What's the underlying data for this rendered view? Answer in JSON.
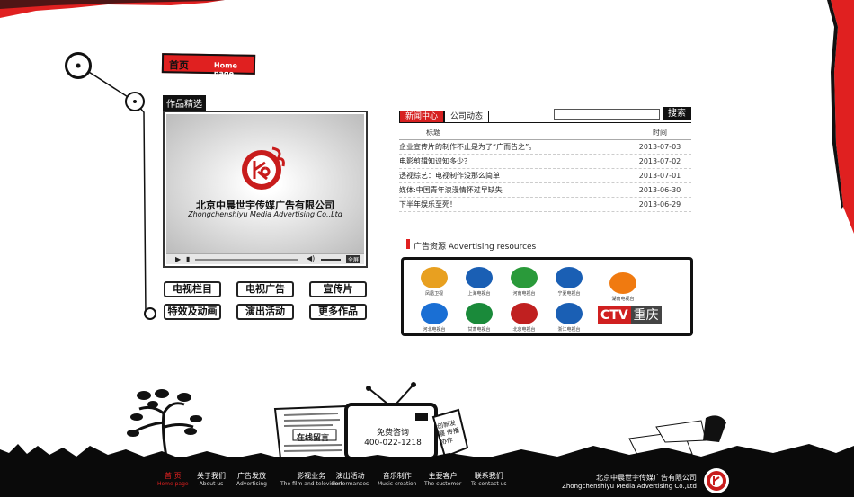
{
  "header": {
    "home_tab_zh": "首页",
    "home_tab_en": "Home page"
  },
  "works": {
    "section_label": "作品精选",
    "video_company_zh": "北京中晨世宇传媒广告有限公司",
    "video_company_en": "Zhongchenshiyu Media Advertising Co.,Ltd",
    "fullscreen_label": "全屏",
    "buttons": [
      "电视栏目",
      "电视广告",
      "宣传片",
      "特效及动画",
      "演出活动",
      "更多作品"
    ]
  },
  "news": {
    "tabs": [
      "新闻中心",
      "公司动态"
    ],
    "search_placeholder": "",
    "search_button": "搜索",
    "col_title": "标题",
    "col_date": "时间",
    "rows": [
      {
        "title": "企业宣传片的制作不止是为了“广而告之”。",
        "date": "2013-07-03"
      },
      {
        "title": "电影剪辑知识知多少？",
        "date": "2013-07-02"
      },
      {
        "title": "透视综艺：电视制作没那么简单",
        "date": "2013-07-01"
      },
      {
        "title": "媒体:中国青年浪漫情怀过早缺失",
        "date": "2013-06-30"
      },
      {
        "title": "下半年娱乐至死！",
        "date": "2013-06-29"
      }
    ]
  },
  "ads": {
    "title": "广告资源 Advertising resources",
    "logos": [
      {
        "name": "凤凰卫视",
        "color": "#e8a020"
      },
      {
        "name": "上海电视台",
        "color": "#1a5fb4"
      },
      {
        "name": "河南电视台",
        "color": "#2a9a3a"
      },
      {
        "name": "宁夏电视台",
        "color": "#1a5fb4"
      },
      {
        "name": "湖南电视台",
        "color": "#f07a10"
      },
      {
        "name": "河北电视台",
        "color": "#1a6fd4"
      },
      {
        "name": "甘肃电视台",
        "color": "#1a8a3a"
      },
      {
        "name": "北京电视台",
        "color": "#c02020"
      },
      {
        "name": "浙江电视台",
        "color": "#1a5fb4"
      },
      {
        "name": "",
        "color": "#d02020"
      }
    ],
    "cctv_text": "CTV",
    "chongqing_text": "重庆"
  },
  "promo": {
    "consult_label": "免费咨询",
    "phone": "400-022-1218",
    "online_msg": "在线留言",
    "tag_text": "创新发展 传播协作"
  },
  "footer": {
    "nav": [
      {
        "zh": "首 页",
        "en": "Home page",
        "active": true
      },
      {
        "zh": "关于我们",
        "en": "About us"
      },
      {
        "zh": "广告发放",
        "en": "Advertising"
      },
      {
        "zh": "影视业务",
        "en": "The film and television"
      },
      {
        "zh": "演出活动",
        "en": "Performances"
      },
      {
        "zh": "音乐制作",
        "en": "Music creation"
      },
      {
        "zh": "主要客户",
        "en": "The customer"
      },
      {
        "zh": "联系我们",
        "en": "To contact us"
      }
    ],
    "company_zh": "北京中晨世宇传媒广告有限公司",
    "company_en": "Zhongchenshiyu Media Advertising Co.,Ltd"
  },
  "colors": {
    "accent": "#e02020",
    "dark": "#0a0a0a"
  }
}
